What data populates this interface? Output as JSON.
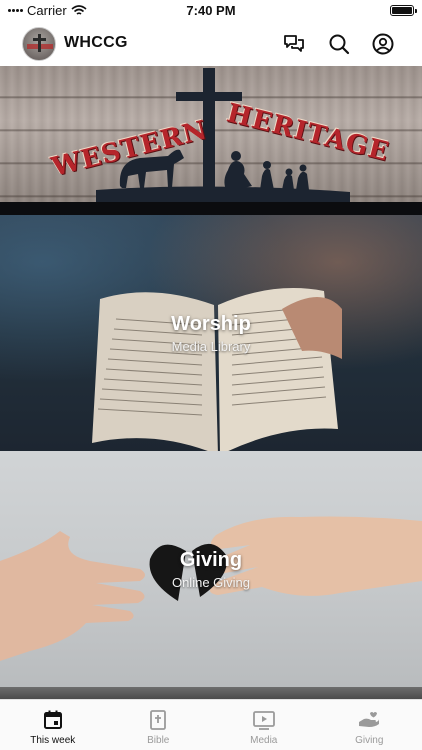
{
  "status_bar": {
    "carrier": "Carrier",
    "time": "7:40 PM"
  },
  "header": {
    "title": "WHCCG",
    "avatar_icon": "church-logo-icon",
    "icons": [
      "chat-icon",
      "search-icon",
      "account-icon"
    ]
  },
  "banner": {
    "word_left": "WESTERN",
    "word_right": "HERITAGE"
  },
  "tiles": [
    {
      "title": "Worship",
      "subtitle": "Media Library"
    },
    {
      "title": "Giving",
      "subtitle": "Online Giving"
    }
  ],
  "tab_bar": {
    "items": [
      {
        "label": "This week",
        "icon": "calendar-icon",
        "active": true
      },
      {
        "label": "Bible",
        "icon": "bible-icon",
        "active": false
      },
      {
        "label": "Media",
        "icon": "play-icon",
        "active": false
      },
      {
        "label": "Giving",
        "icon": "giving-hand-icon",
        "active": false
      }
    ]
  },
  "colors": {
    "accent": "#111111",
    "inactive": "#9a9a9a",
    "banner_red": "#b5252b"
  }
}
